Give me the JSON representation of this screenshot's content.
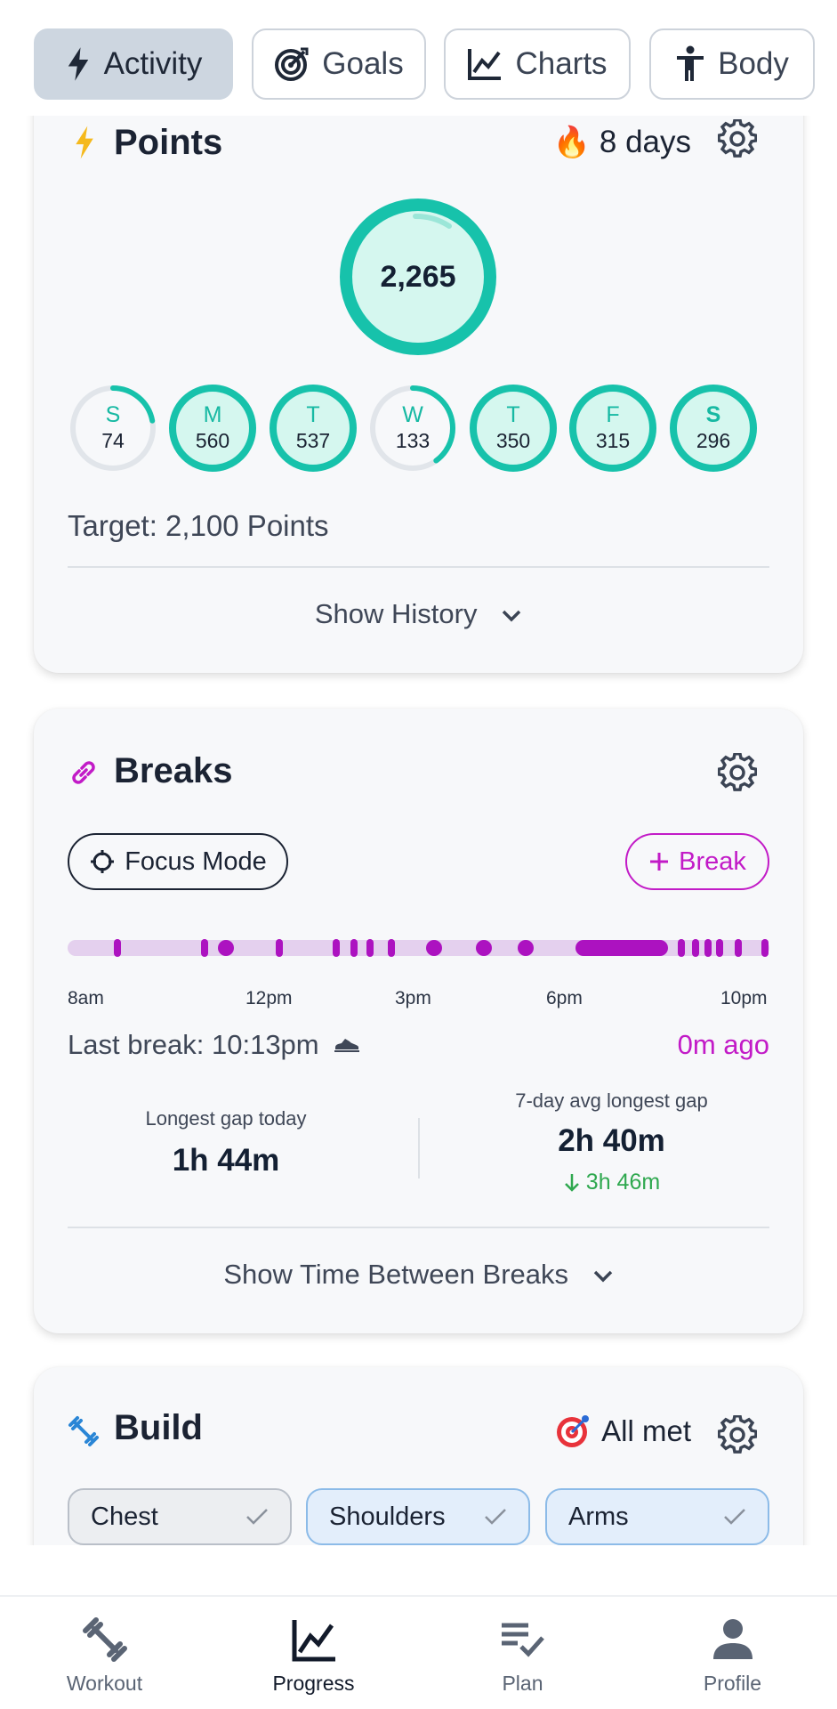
{
  "tabs": [
    {
      "label": "Activity",
      "icon": "bolt-icon",
      "active": true
    },
    {
      "label": "Goals",
      "icon": "target-icon",
      "active": false
    },
    {
      "label": "Charts",
      "icon": "line-chart-icon",
      "active": false
    },
    {
      "label": "Body",
      "icon": "person-icon",
      "active": false
    }
  ],
  "points": {
    "title": "Points",
    "streak": "8 days",
    "total": "2,265",
    "days": [
      {
        "letter": "S",
        "value": "74",
        "progress": 0.22,
        "full": false,
        "bold": false
      },
      {
        "letter": "M",
        "value": "560",
        "progress": 1,
        "full": true,
        "bold": false
      },
      {
        "letter": "T",
        "value": "537",
        "progress": 1,
        "full": true,
        "bold": false
      },
      {
        "letter": "W",
        "value": "133",
        "progress": 0.4,
        "full": false,
        "bold": false
      },
      {
        "letter": "T",
        "value": "350",
        "progress": 1,
        "full": true,
        "bold": false
      },
      {
        "letter": "F",
        "value": "315",
        "progress": 1,
        "full": true,
        "bold": false
      },
      {
        "letter": "S",
        "value": "296",
        "progress": 1,
        "full": true,
        "bold": true
      }
    ],
    "target": "Target: 2,100 Points",
    "show_history": "Show History"
  },
  "breaks": {
    "title": "Breaks",
    "focus_mode": "Focus Mode",
    "add_break": "Break",
    "timeline_labels": [
      "8am",
      "12pm",
      "3pm",
      "6pm",
      "10pm"
    ],
    "last_break": "Last break: 10:13pm",
    "ago": "0m ago",
    "longest_today_label": "Longest gap today",
    "longest_today_value": "1h 44m",
    "avg_label": "7-day avg longest gap",
    "avg_value": "2h 40m",
    "avg_delta": "3h 46m",
    "show_between": "Show Time Between Breaks"
  },
  "build": {
    "title": "Build",
    "status": "All met",
    "chips": [
      "Chest",
      "Shoulders",
      "Arms"
    ]
  },
  "nav": [
    {
      "label": "Workout",
      "icon": "dumbbell-icon",
      "active": false
    },
    {
      "label": "Progress",
      "icon": "progress-chart-icon",
      "active": true
    },
    {
      "label": "Plan",
      "icon": "checklist-icon",
      "active": false
    },
    {
      "label": "Profile",
      "icon": "profile-icon",
      "active": false
    }
  ],
  "colors": {
    "teal": "#17c2ab",
    "magenta": "#c21bc7",
    "green": "#2fa84f",
    "active_tab": "#cdd6e0"
  }
}
